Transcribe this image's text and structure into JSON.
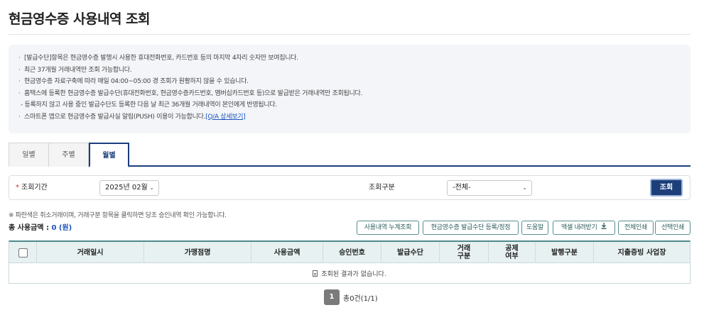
{
  "page": {
    "title": "현금영수증 사용내역 조회"
  },
  "notice": {
    "lines": [
      "[발급수단]항목은 현금영수증 발행시 사용한 휴대전화번호, 카드번호 등의 마지막 4자리 숫자만 보여집니다.",
      "최근 37개월 거래내역만 조회 가능합니다.",
      "현금영수증 자료구축에 따라 매일 04:00~05:00 경 조회가 원활하지 않을 수 있습니다.",
      "홈택스에 등록한 현금영수증 발급수단(휴대전화번호, 현금영수증카드번호, 멤버십카드번호 등)으로 발급받은 거래내역만 조회됩니다.",
      "- 등록하지 않고 사용 중인 발급수단도 등록한 다음 날 최근 36개월 거래내역이 본인에게 반영됩니다.",
      "스마트폰 앱으로 현금영수증 발급사실 알림(PUSH) 이용이 가능합니다."
    ],
    "link_label": "[Q/A 상세보기]"
  },
  "tabs": [
    {
      "label": "일별"
    },
    {
      "label": "주별"
    },
    {
      "label": "월별",
      "active": true
    }
  ],
  "search": {
    "period_label": "조회기간",
    "period_value": "2025년 02월",
    "type_label": "조회구분",
    "type_value": "-전체-",
    "submit_label": "조회"
  },
  "hint": "※ 파란색은 취소거래이며, 거래구분 항목을 클릭하면 당초 승인내역 확인 가능합니다.",
  "total": {
    "label": "총 사용금액 : ",
    "amount": "0 (원)"
  },
  "actions": [
    "사용내역 누계조회",
    "현금영수증 발급수단 등록/정정",
    "도움말",
    "엑셀 내려받기",
    "전체인쇄",
    "선택인쇄"
  ],
  "icons": {
    "excel_download": "download-icon",
    "empty_result": "document-icon",
    "select_chevron": "chevron-down-icon"
  },
  "colors": {
    "primary": "#1c3f7a",
    "table_accent": "#4f8a8b",
    "link": "#1a53c2",
    "required": "#d23"
  },
  "table": {
    "columns": [
      "거래일시",
      "가맹점명",
      "사용금액",
      "승인번호",
      "발급수단",
      "거래\n구분",
      "공제\n여부",
      "발행구분",
      "지출증빙 사업장"
    ],
    "empty_message": "조회된 결과가 없습니다."
  },
  "pagination": {
    "current": "1",
    "info": "총0건(1/1)"
  }
}
